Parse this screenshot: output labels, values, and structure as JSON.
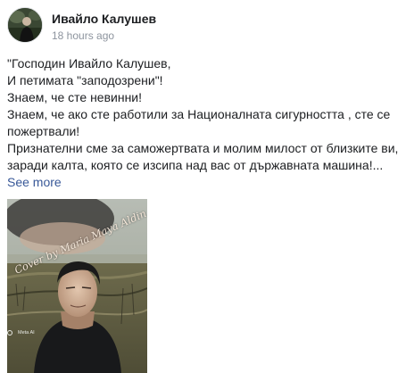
{
  "post": {
    "author": "Ивайло Калушев",
    "timestamp": "18 hours ago",
    "text_lines": [
      "\"Господин Ивайло Калушев,",
      "И петимата \"заподозрени\"!",
      "Знаем, че сте невинни!",
      "Знаем, че ако сте работили за Националната сигурността , сте се",
      "пожертвали!",
      "Признателни сме за саможертвата и молим милост от близките ви,",
      "заради калта, която се изсипа над вас от държавната машина!..."
    ],
    "see_more_label": "See more",
    "image": {
      "watermark_text": "Cover by Maria Maya Aldin",
      "badge_text": "Meta AI"
    }
  },
  "colors": {
    "author_text": "#1c1e21",
    "timestamp_text": "#8d949e",
    "body_text": "#1c1e21",
    "link": "#385898"
  },
  "icons": {
    "avatar": "profile-photo",
    "badge": "meta-ai-ring-icon"
  }
}
